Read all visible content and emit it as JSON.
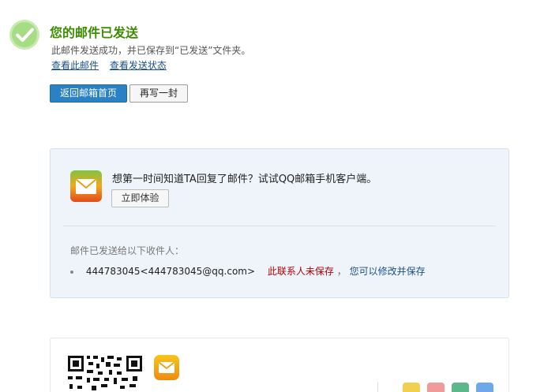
{
  "header": {
    "title": "您的邮件已发送",
    "subtitle": "此邮件发送成功，并已保存到“已发送”文件夹。",
    "link_view_mail": "查看此邮件",
    "link_view_status": "查看发送状态"
  },
  "actions": {
    "back_label": "返回邮箱首页",
    "write_again_label": "再写一封"
  },
  "promo": {
    "text": "想第一时间知道TA回复了邮件？试试QQ邮箱手机客户端。",
    "try_label": "立即体验"
  },
  "recipients": {
    "label": "邮件已发送给以下收件人：",
    "items": [
      {
        "email": "444783045<444783045@qq.com>",
        "status": "此联系人未保存",
        "separator": "，",
        "hint": "您可以修改并保存"
      }
    ]
  },
  "colors": {
    "title_green": "#3b8d00",
    "link_blue": "#1b4f8a",
    "primary_button": "#2a81c4",
    "warning_red": "#b00000",
    "panel_bg": "#eff4fb"
  },
  "icons": {
    "success": "check-circle-icon",
    "promo": "qq-mail-app-icon",
    "qr": "qr-code-icon"
  }
}
